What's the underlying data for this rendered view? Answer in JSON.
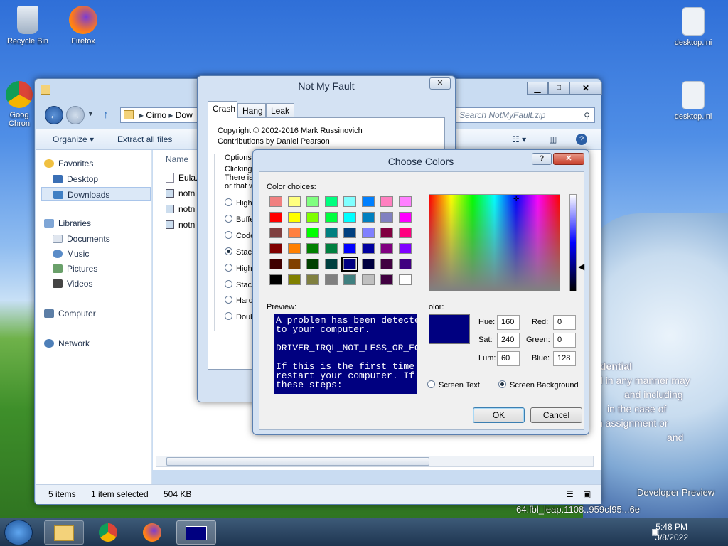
{
  "desktop": {
    "icons": [
      {
        "label": "Recycle Bin"
      },
      {
        "label": "Firefox"
      },
      {
        "label": "Goog Chron"
      },
      {
        "label": "desktop.ini"
      },
      {
        "label": "desktop.ini"
      }
    ],
    "watermark": {
      "line1": "idential",
      "line2": "d in any manner may",
      "line3": "and including",
      "line4": "in the case of",
      "line5": "n assignment or",
      "line6": "and",
      "build_line1": "Developer Preview",
      "build_line2": "64.fbl_leap.1108..959cf95...6e"
    }
  },
  "explorer": {
    "breadcrumb": [
      "Cirno",
      "Dow"
    ],
    "search_placeholder": "Search NotMyFault.zip",
    "toolbar": {
      "organize": "Organize",
      "extract": "Extract all files"
    },
    "nav": {
      "favorites": "Favorites",
      "desktop": "Desktop",
      "downloads": "Downloads",
      "libraries": "Libraries",
      "documents": "Documents",
      "music": "Music",
      "pictures": "Pictures",
      "videos": "Videos",
      "computer": "Computer",
      "network": "Network"
    },
    "column_name": "Name",
    "files": [
      "Eula.",
      "notn",
      "notn",
      "notn"
    ],
    "status": {
      "count": "5 items",
      "selected": "1 item selected",
      "size": "504 KB"
    }
  },
  "nmf": {
    "title": "Not My Fault",
    "close": "✕",
    "tabs": [
      "Crash",
      "Hang",
      "Leak"
    ],
    "copyright": "Copyright © 2002-2016 Mark Russinovich",
    "contrib": "Contributions by Daniel Pearson",
    "options_label": "Options",
    "options_text": [
      "Clicking t",
      "There is",
      "or that w"
    ],
    "radios": [
      "High",
      "Buffe",
      "Code",
      "Stack",
      "High",
      "Stack",
      "Hardc",
      "Doub"
    ],
    "selected_radio": 3
  },
  "cc": {
    "title": "Choose Colors",
    "help": "?",
    "close": "✕",
    "color_choices_label": "Color choices:",
    "swatches": [
      [
        "#f08080",
        "#ffff80",
        "#80ff80",
        "#00ff80",
        "#80ffff",
        "#0080ff",
        "#ff80c0",
        "#ff80ff"
      ],
      [
        "#ff0000",
        "#ffff00",
        "#80ff00",
        "#00ff40",
        "#00ffff",
        "#0080c0",
        "#8080c0",
        "#ff00ff"
      ],
      [
        "#804040",
        "#ff8040",
        "#00ff00",
        "#008080",
        "#004080",
        "#8080ff",
        "#800040",
        "#ff0080"
      ],
      [
        "#800000",
        "#ff8000",
        "#008000",
        "#008040",
        "#0000ff",
        "#0000a0",
        "#800080",
        "#8000ff"
      ],
      [
        "#400000",
        "#804000",
        "#004000",
        "#004040",
        "#000080",
        "#000040",
        "#400040",
        "#400080"
      ],
      [
        "#000000",
        "#808000",
        "#808040",
        "#808080",
        "#408080",
        "#c0c0c0",
        "#400040",
        "#ffffff"
      ]
    ],
    "preview_label": "Preview:",
    "preview_text": "A problem has been detected\nto your computer.\n\nDRIVER_IRQL_NOT_LESS_OR_EQUAL\n\nIf this is the first time\nrestart your computer. If\nthese steps:",
    "color_label": "olor:",
    "selected_color": "#000080",
    "hue_label": "Hue:",
    "hue": "160",
    "sat_label": "Sat:",
    "sat": "240",
    "lum_label": "Lum:",
    "lum": "60",
    "red_label": "Red:",
    "red": "0",
    "green_label": "Green:",
    "green": "0",
    "blue_label": "Blue:",
    "blue": "128",
    "screen_text": "Screen Text",
    "screen_background": "Screen Background",
    "ok": "OK",
    "cancel": "Cancel"
  },
  "taskbar": {
    "time": "5:48 PM",
    "date": "3/8/2022"
  }
}
